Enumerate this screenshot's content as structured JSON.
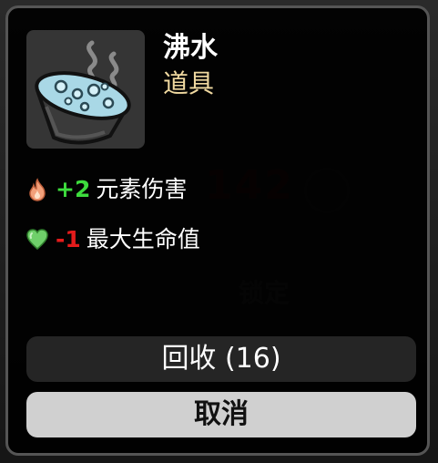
{
  "item": {
    "name": "沸水",
    "type": "道具",
    "icon": "boiling-water-pot-icon"
  },
  "stats": [
    {
      "icon": "flame-icon",
      "value": "+2",
      "value_color": "#3ddc3d",
      "label": "元素伤害"
    },
    {
      "icon": "heart-icon",
      "value": "-1",
      "value_color": "#e41b1b",
      "label": "最大生命值"
    }
  ],
  "buttons": {
    "recycle": "回收 (16)",
    "cancel": "取消"
  },
  "background": {
    "number": "142",
    "lock_label": "锁定"
  },
  "colors": {
    "popup_bg": "#000000",
    "type_text": "#f0d9a0",
    "positive": "#3ddc3d",
    "negative": "#e41b1b",
    "cancel_button": "#d0d0d0",
    "recycle_button": "#252525"
  }
}
